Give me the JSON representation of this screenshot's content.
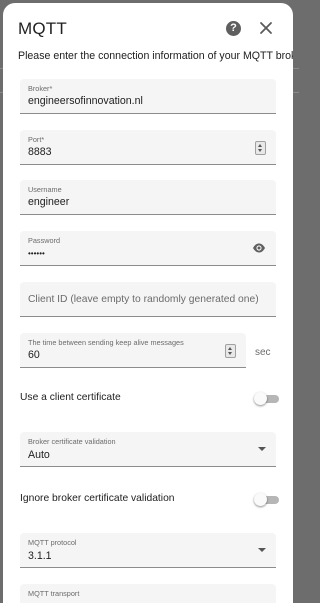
{
  "dialog": {
    "title": "MQTT",
    "intro": "Please enter the connection information of your MQTT broker."
  },
  "fields": {
    "broker": {
      "label": "Broker*",
      "value": "engineersofinnovation.nl"
    },
    "port": {
      "label": "Port*",
      "value": "8883"
    },
    "username": {
      "label": "Username",
      "value": "engineer"
    },
    "password": {
      "label": "Password",
      "value": "••••••"
    },
    "client_id": {
      "placeholder": "Client ID (leave empty to randomly generated one)"
    },
    "keepalive": {
      "label": "The time between sending keep alive messages",
      "value": "60",
      "suffix": "sec"
    },
    "broker_cert_validation": {
      "label": "Broker certificate validation",
      "value": "Auto"
    },
    "mqtt_protocol": {
      "label": "MQTT protocol",
      "value": "3.1.1"
    },
    "mqtt_transport": {
      "label": "MQTT transport"
    }
  },
  "toggles": {
    "client_cert": {
      "label": "Use a client certificate",
      "on": false
    },
    "ignore_cert": {
      "label": "Ignore broker certificate validation",
      "on": false
    }
  },
  "icons": {
    "help": "help-icon",
    "close": "close-icon",
    "eye": "eye-icon"
  }
}
